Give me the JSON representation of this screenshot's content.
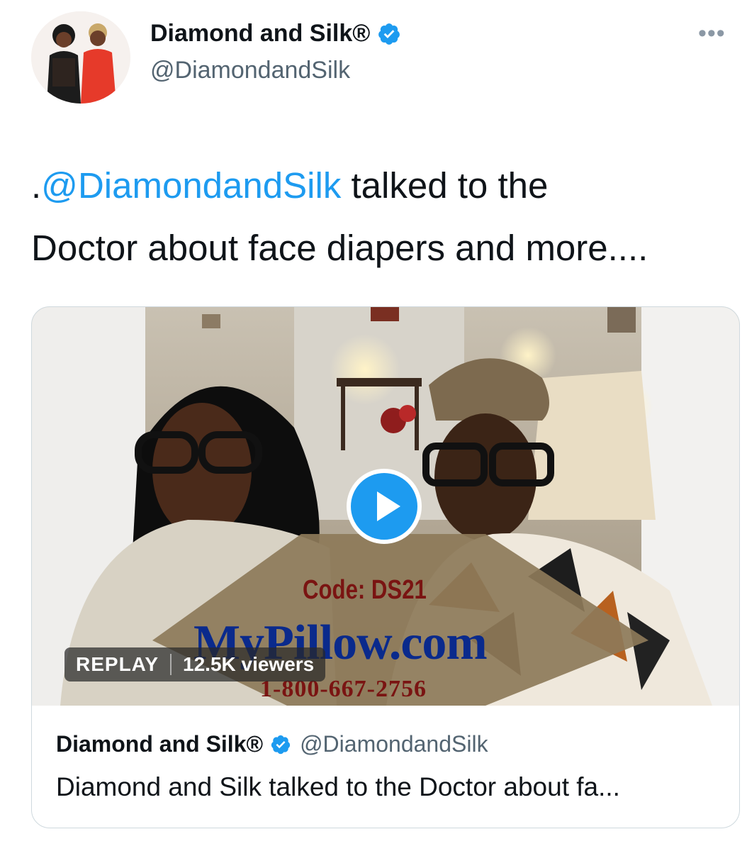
{
  "author": {
    "name": "Diamond and Silk®",
    "handle": "@DiamondandSilk",
    "verified": true
  },
  "tweet": {
    "prefix": ".",
    "mention": "@DiamondandSilk",
    "text_after_mention": " talked to the",
    "text_line2": "Doctor about face diapers and more...."
  },
  "media": {
    "replay_label": "REPLAY",
    "viewers": "12.5K viewers",
    "overlay_code": "Code: DS21",
    "overlay_site": "MyPillow.com",
    "overlay_phone": "1-800-667-2756",
    "play_icon": "play-icon"
  },
  "card": {
    "name": "Diamond and Silk®",
    "handle": "@DiamondandSilk",
    "description": "Diamond and Silk talked to the Doctor about fa..."
  },
  "colors": {
    "accent": "#1d9bf0",
    "secondary_text": "#536471",
    "border": "#cfd9de"
  }
}
